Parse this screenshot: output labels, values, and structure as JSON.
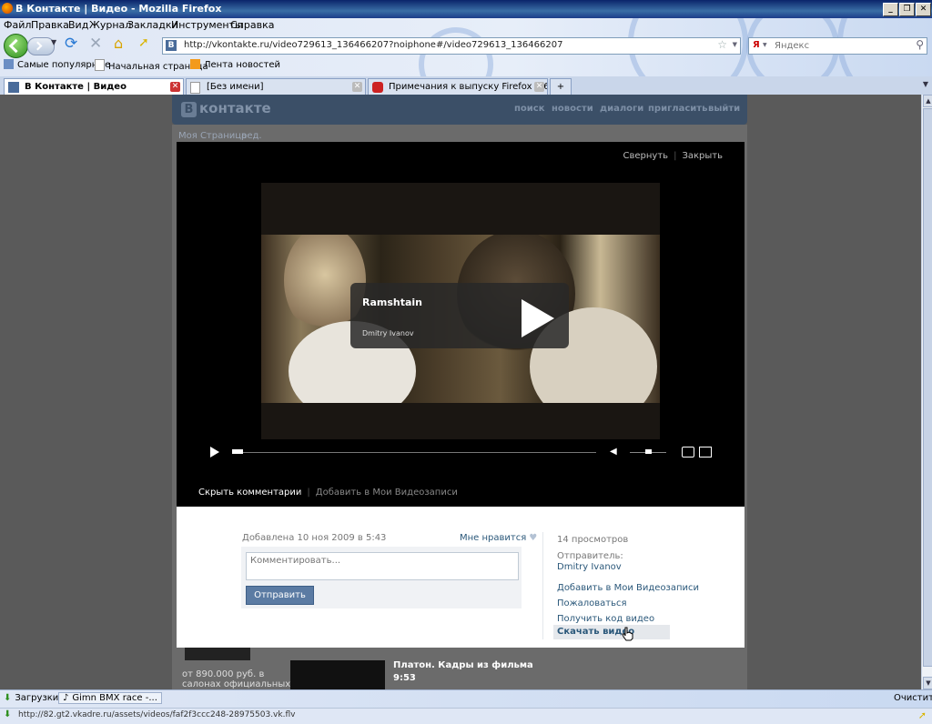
{
  "window": {
    "title": "В Контакте | Видео - Mozilla Firefox",
    "controls": [
      "_",
      "❐",
      "✕"
    ]
  },
  "menu": [
    "Файл",
    "Правка",
    "Вид",
    "Журнал",
    "Закладки",
    "Инструменты",
    "Справка"
  ],
  "navbar": {
    "url": "http://vkontakte.ru/video729613_136466207?noiphone#/video729613_136466207",
    "url_favicon": "B",
    "search_engine": "Я",
    "search_placeholder": "Яндекс"
  },
  "bookmarks": [
    "Самые популярные",
    "Начальная страница",
    "Лента новостей"
  ],
  "tabs": [
    {
      "label": "В Контакте | Видео",
      "active": true
    },
    {
      "label": "[Без имени]",
      "active": false
    },
    {
      "label": "Примечания к выпуску Firefox 3.6.14 |",
      "active": false
    }
  ],
  "new_tab": "+",
  "vk": {
    "logo_letter": "B",
    "logo": "контакте",
    "nav": [
      "поиск",
      "новости",
      "диалоги",
      "пригласить",
      "выйти"
    ],
    "left_menu_item": "Моя Страница",
    "left_menu_edit": "ред."
  },
  "overlay": {
    "collapse": "Свернуть",
    "close": "Закрыть",
    "video_title": "Ramshtain",
    "video_author": "Dmitry Ivanov",
    "hide_comments": "Скрыть комментарии",
    "add_to_my_videos": "Добавить в Мои Видеозаписи",
    "playback_progress": 0.0,
    "volume_level": 0.5
  },
  "panel": {
    "added": "Добавлена 10 ноя 2009 в 5:43",
    "like": "Мне нравится",
    "comment_placeholder": "Комментировать...",
    "send": "Отправить",
    "views": "14 просмотров",
    "sender_label": "Отправитель:",
    "sender": "Dmitry Ivanov",
    "links": [
      "Добавить в Мои Видеозаписи",
      "Пожаловаться",
      "Получить код видео"
    ],
    "download": "Скачать видео"
  },
  "background_page": {
    "promo_line1": "от 890.000 руб. в",
    "promo_line2": "салонах официальных",
    "next_video_title": "Платон. Кадры из фильма",
    "next_video_time": "9:53"
  },
  "downloads": {
    "label": "Загрузки",
    "item": "Gimn BMX race -...",
    "clear": "Очистить"
  },
  "status": {
    "text": "http://82.gt2.vkadre.ru/assets/videos/faf2f3ccc248-28975503.vk.flv"
  }
}
